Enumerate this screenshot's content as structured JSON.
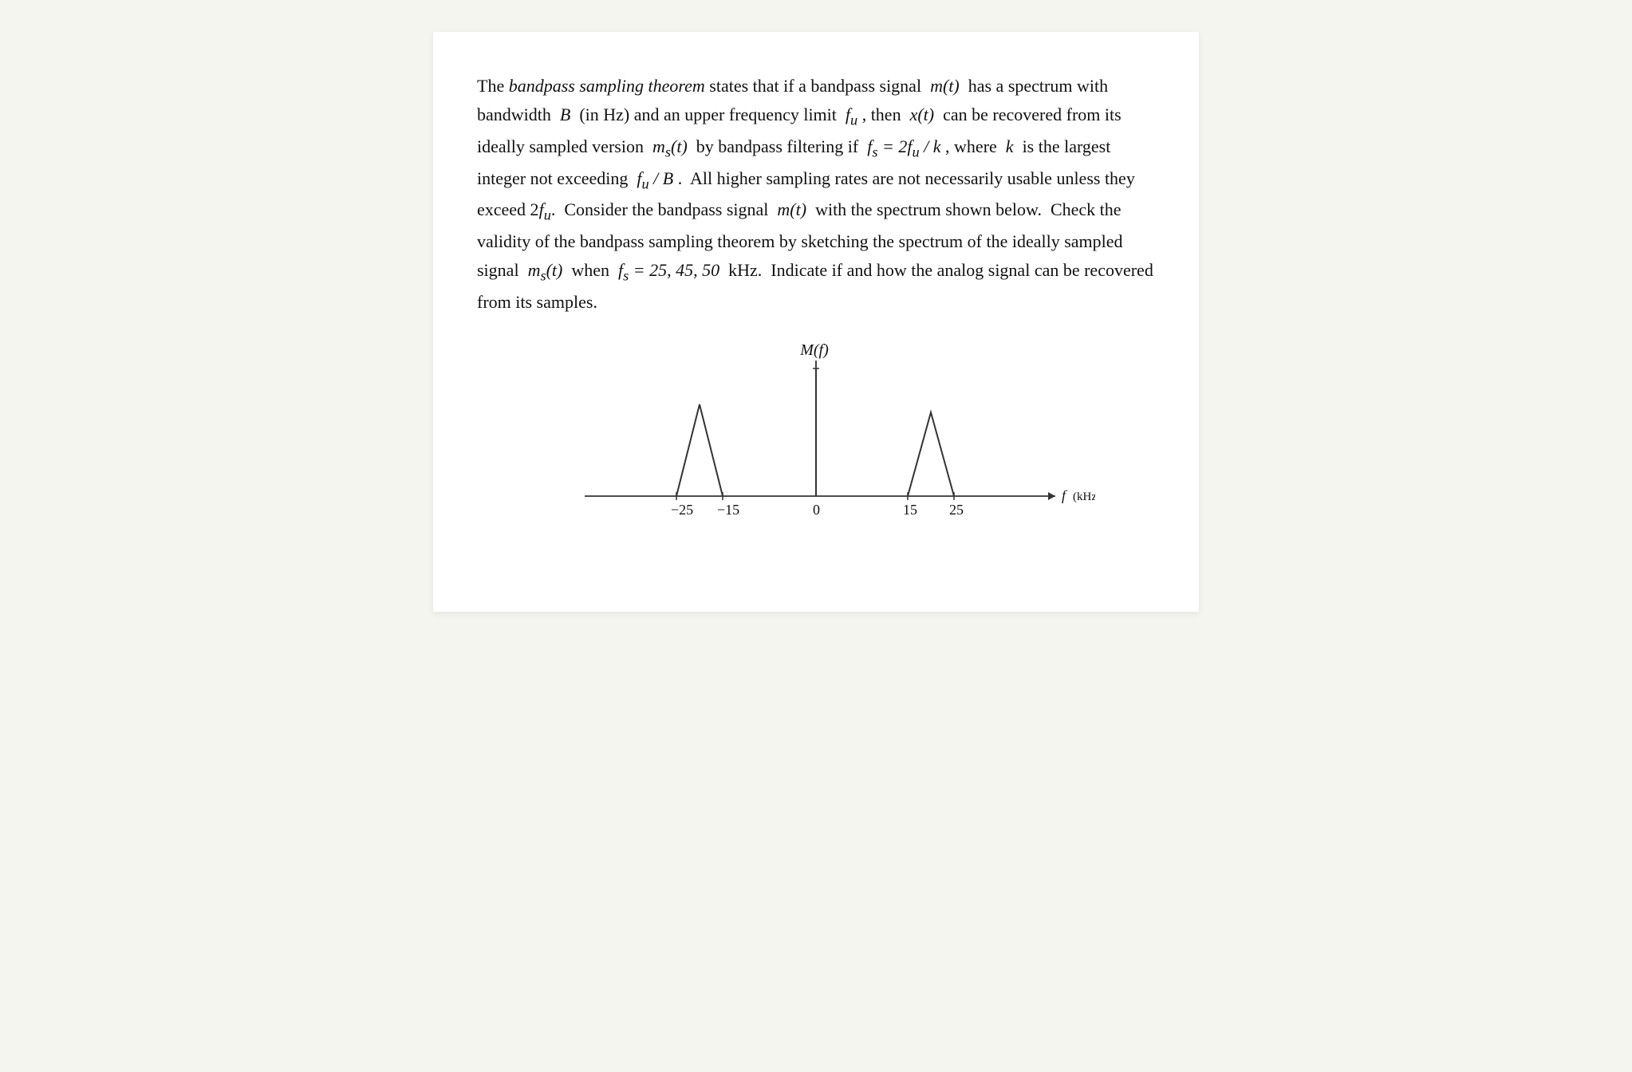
{
  "page": {
    "background": "#ffffff",
    "text_content": {
      "paragraph": "The bandpass sampling theorem states that if a bandpass signal m(t) has a spectrum with bandwidth B (in Hz) and an upper frequency limit f_u, then x(t) can be recovered from its ideally sampled version m_s(t) by bandpass filtering if f_s = 2f_u/k, where k is the largest integer not exceeding f_u/B. All higher sampling rates are not necessarily usable unless they exceed 2f_u. Consider the bandpass signal m(t) with the spectrum shown below. Check the validity of the bandpass sampling theorem by sketching the spectrum of the ideally sampled signal m_s(t) when f_s = 25, 45, 50 kHz. Indicate if and how the analog signal can be recovered from its samples."
    },
    "chart": {
      "x_axis_label": "f (kHz)",
      "y_axis_label": "M(f)",
      "x_ticks": [
        "-25",
        "-15",
        "0",
        "15",
        "25"
      ],
      "x_unit": "kHz"
    },
    "colors": {
      "text": "#111111",
      "axis": "#333333",
      "background": "#ffffff"
    }
  }
}
